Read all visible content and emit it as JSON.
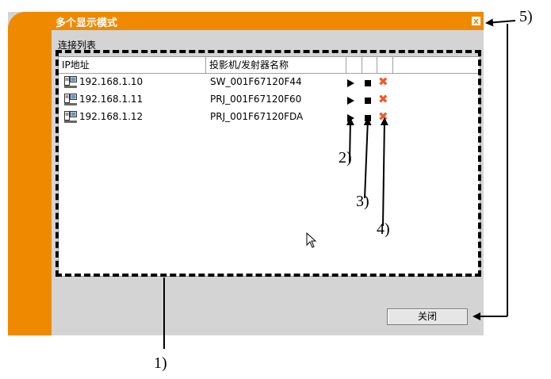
{
  "dialog": {
    "title": "多个显示模式",
    "close_glyph": "x",
    "group_label": "连接列表",
    "columns": [
      "IP地址",
      "投影机/发射器名称",
      "",
      "",
      "",
      ""
    ],
    "rows": [
      {
        "ip": "192.168.1.10",
        "name": "SW_001F67120F44",
        "delete_glyph": "✖"
      },
      {
        "ip": "192.168.1.11",
        "name": "PRJ_001F67120F60",
        "delete_glyph": "✖"
      },
      {
        "ip": "192.168.1.12",
        "name": "PRJ_001F67120FDA",
        "delete_glyph": "✖"
      }
    ],
    "close_button_label": "关闭"
  },
  "callouts": {
    "c1": "1)",
    "c2": "2)",
    "c3": "3)",
    "c4": "4)",
    "c5": "5)"
  },
  "colors": {
    "accent": "#ef8a00",
    "delete": "#f05a28",
    "panel": "#d4d4d4"
  },
  "icons": [
    "computer-icon",
    "play-icon",
    "stop-icon",
    "delete-icon",
    "close-icon",
    "cursor-icon"
  ]
}
